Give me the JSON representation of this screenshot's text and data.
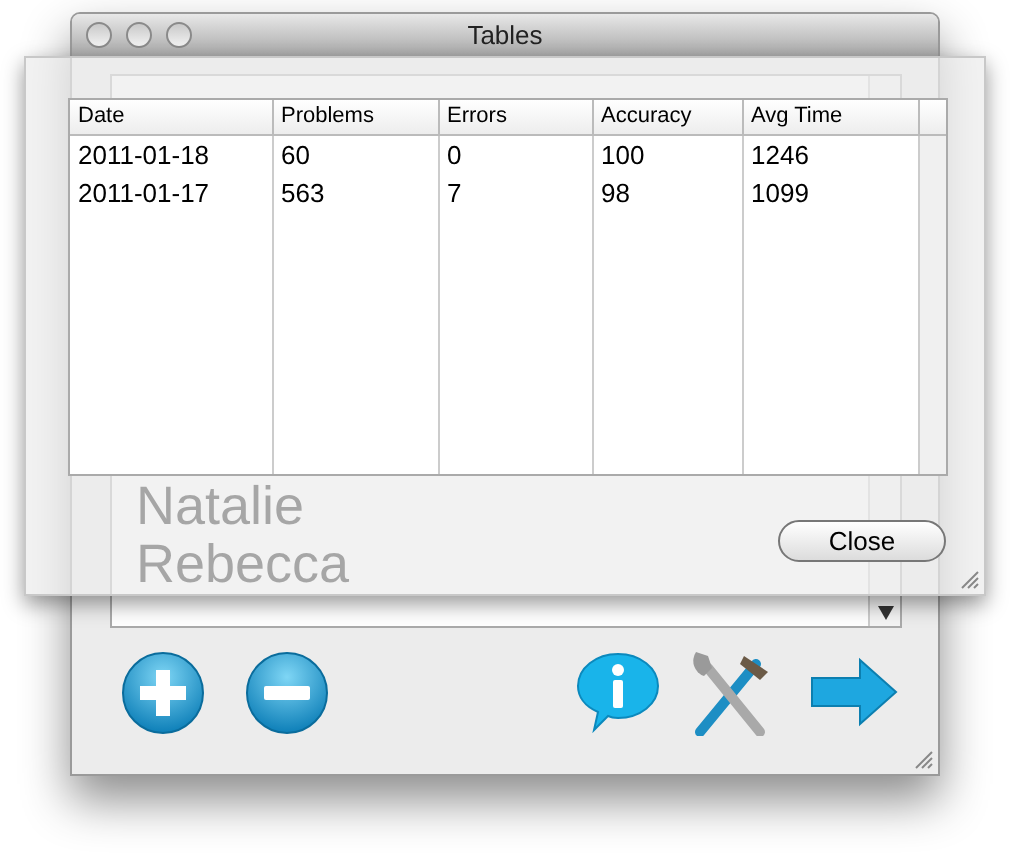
{
  "window": {
    "title": "Tables"
  },
  "name_list": {
    "items": [
      "Natalie",
      "Rebecca"
    ]
  },
  "table": {
    "columns": [
      "Date",
      "Problems",
      "Errors",
      "Accuracy",
      "Avg Time"
    ],
    "rows": [
      [
        "2011-01-18",
        "60",
        "0",
        "100",
        "1246"
      ],
      [
        "2011-01-17",
        "563",
        "7",
        "98",
        "1099"
      ]
    ]
  },
  "close_button": {
    "label": "Close"
  }
}
